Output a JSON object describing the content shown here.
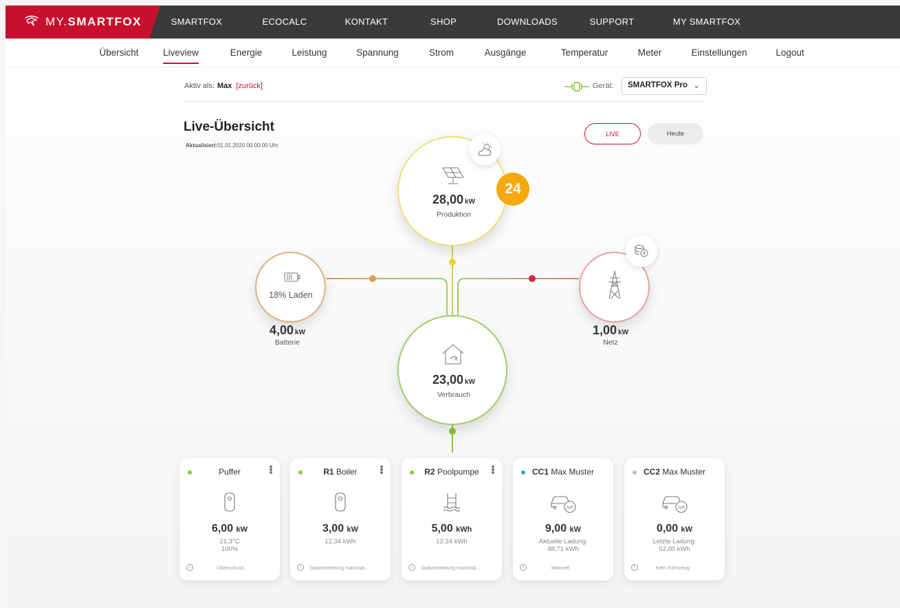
{
  "brand": {
    "light": "MY.",
    "strong": "SMARTFOX"
  },
  "topnav": [
    "SMARTFOX",
    "ECOCALC",
    "KONTAKT",
    "SHOP",
    "DOWNLOADS",
    "SUPPORT",
    "MY SMARTFOX"
  ],
  "subnav": [
    "Übersicht",
    "Liveview",
    "Energie",
    "Leistung",
    "Spannung",
    "Strom",
    "Ausgänge",
    "Temperatur",
    "Meter",
    "Einstellungen",
    "Logout"
  ],
  "subnav_active": "Liveview",
  "info": {
    "aktiv_label": "Aktiv als:",
    "user": "Max",
    "back": "[zurück]",
    "geraet_label": "Gerät:",
    "geraet_value": "SMARTFOX Pro"
  },
  "header": {
    "title": "Live-Übersicht",
    "updated_label": "Aktualisiert:",
    "updated_value": "01.01.2020 00:00:00 Uhr"
  },
  "buttons": {
    "live": "LIVE",
    "heute": "Heute"
  },
  "produktion": {
    "value": "28,00",
    "unit": "kW",
    "label": "Produktion",
    "badge": "24"
  },
  "verbrauch": {
    "value": "23,00",
    "unit": "kW",
    "label": "Verbrauch"
  },
  "batterie": {
    "status": "18% Laden",
    "value": "4,00",
    "unit": "kW",
    "label": "Batterie"
  },
  "netz": {
    "value": "1,00",
    "unit": "kW",
    "label": "Netz"
  },
  "colors": {
    "brand_red": "#c8102e",
    "production": "#e8dc55",
    "consumption": "#8cc63f",
    "battery": "#d9a057",
    "grid": "#d6253f",
    "badge": "#f5a90f"
  },
  "cards": [
    {
      "dot": "#8cc63f",
      "bold": "",
      "name": "Puffer",
      "value": "6,00",
      "unit": "kW",
      "sub1": "21,3°C",
      "sub2": "100%",
      "footer": "Überschuss",
      "icon": "boiler-icon",
      "menu": true
    },
    {
      "dot": "#8cc63f",
      "bold": "R1",
      "name": " Boiler",
      "value": "3,00",
      "unit": "kW",
      "sub1": "12,34 kWh",
      "sub2": "",
      "footer": "Statusmeldung maximal...",
      "icon": "boiler-icon",
      "menu": true
    },
    {
      "dot": "#8cc63f",
      "bold": "R2",
      "name": " Poolpumpe",
      "value": "5,00",
      "unit": "kWh",
      "sub1": "12,34 kWh",
      "sub2": "",
      "footer": "Statusmeldung maximal...",
      "icon": "pool-icon",
      "menu": true
    },
    {
      "dot": "#3a9ee8",
      "bold": "CC1",
      "name": " Max Muster",
      "value": "9,00",
      "unit": "kW",
      "sub1": "Aktuelle Ladung:",
      "sub2": "48,71 kWh",
      "footer": "Manuell",
      "icon": "car-3ph-icon",
      "icon_text": "3ph",
      "menu": false
    },
    {
      "dot": "#bdbdbd",
      "bold": "CC2",
      "name": " Max Muster",
      "value": "0,00",
      "unit": "kW",
      "sub1": "Letzte Ladung:",
      "sub2": "52,00 kWh",
      "footer": "Kein Fahrzeug",
      "icon": "car-1ph-icon",
      "icon_text": "1ph",
      "menu": false
    }
  ]
}
